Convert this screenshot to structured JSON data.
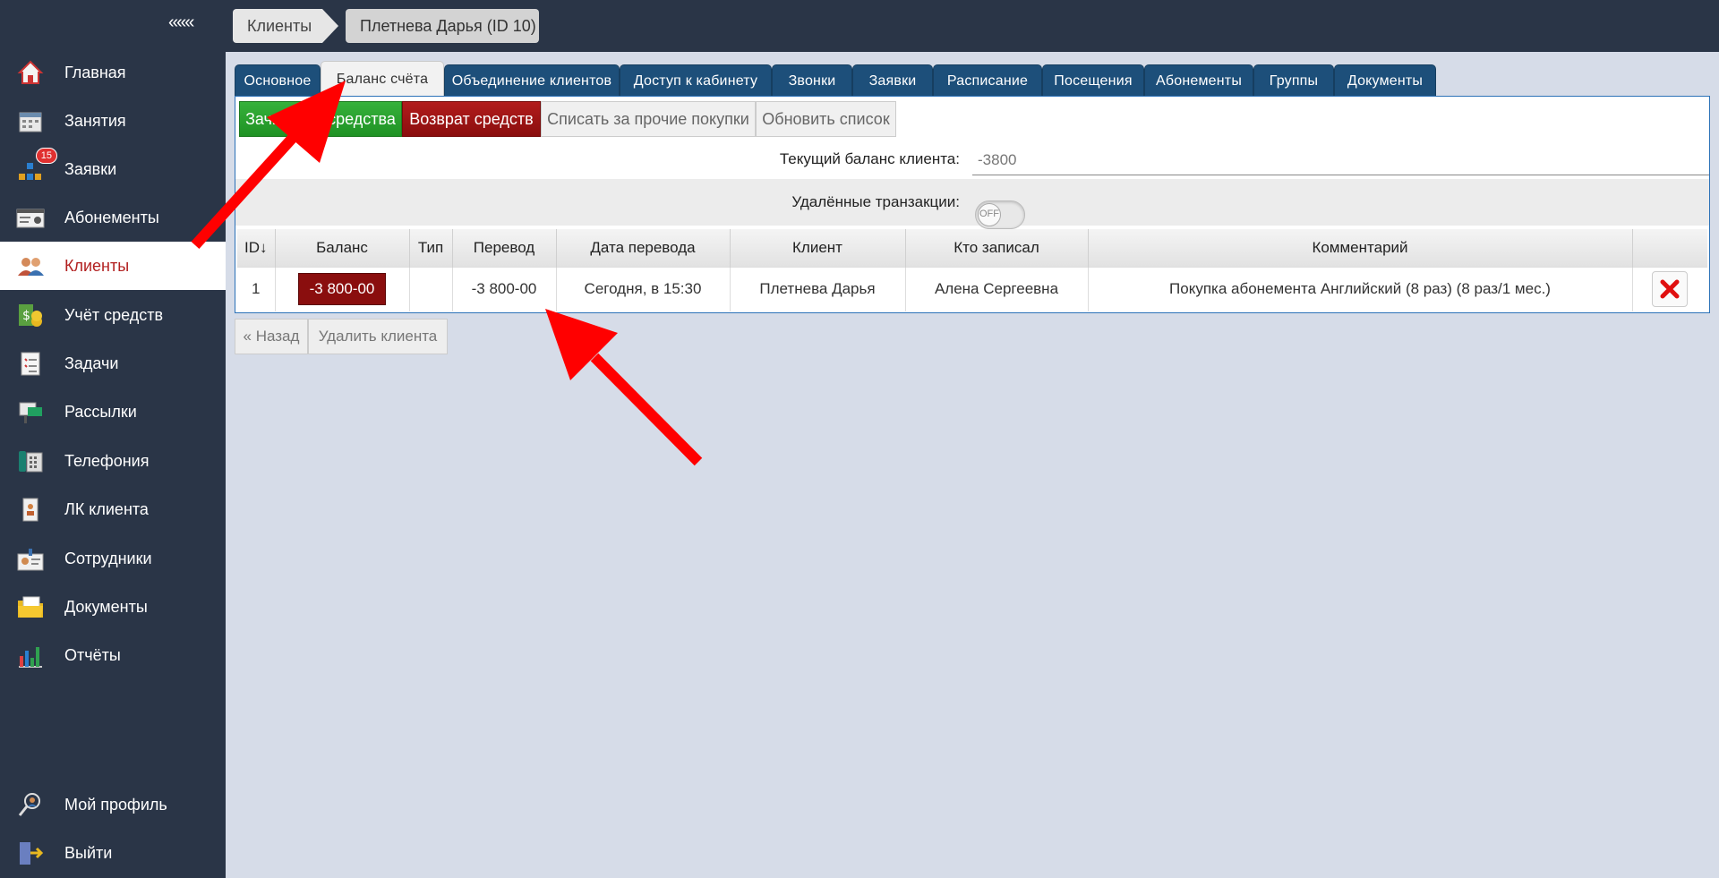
{
  "sidebar": {
    "collapse_label": "«««",
    "items": [
      {
        "label": "Главная",
        "icon": "home-icon"
      },
      {
        "label": "Занятия",
        "icon": "calendar-icon"
      },
      {
        "label": "Заявки",
        "icon": "requests-icon",
        "badge": "15"
      },
      {
        "label": "Абонементы",
        "icon": "membership-card-icon"
      },
      {
        "label": "Клиенты",
        "icon": "clients-icon",
        "active": true
      },
      {
        "label": "Учёт средств",
        "icon": "money-icon"
      },
      {
        "label": "Задачи",
        "icon": "tasks-icon"
      },
      {
        "label": "Рассылки",
        "icon": "mailing-icon"
      },
      {
        "label": "Телефония",
        "icon": "phone-icon"
      },
      {
        "label": "ЛК клиента",
        "icon": "client-cabinet-icon"
      },
      {
        "label": "Сотрудники",
        "icon": "staff-icon"
      },
      {
        "label": "Документы",
        "icon": "documents-icon"
      },
      {
        "label": "Отчёты",
        "icon": "reports-icon"
      }
    ],
    "bottom_items": [
      {
        "label": "Мой профиль",
        "icon": "profile-icon"
      },
      {
        "label": "Выйти",
        "icon": "logout-icon"
      }
    ]
  },
  "breadcrumb": {
    "parent": "Клиенты",
    "current": "Плетнева Дарья (ID 10)"
  },
  "tabs": [
    {
      "label": "Основное"
    },
    {
      "label": "Баланс счёта",
      "active": true
    },
    {
      "label": "Объединение клиентов"
    },
    {
      "label": "Доступ к кабинету"
    },
    {
      "label": "Звонки"
    },
    {
      "label": "Заявки"
    },
    {
      "label": "Расписание"
    },
    {
      "label": "Посещения"
    },
    {
      "label": "Абонементы"
    },
    {
      "label": "Группы"
    },
    {
      "label": "Документы"
    }
  ],
  "actions": {
    "credit": "Зачислить средства",
    "refund": "Возврат средств",
    "debit_other": "Списать за прочие покупки",
    "refresh": "Обновить список"
  },
  "balance": {
    "label": "Текущий баланс клиента:",
    "value": "-3800"
  },
  "deleted": {
    "label": "Удалённые транзакции:",
    "toggle": "OFF"
  },
  "table": {
    "headers": [
      "ID↓",
      "Баланс",
      "Тип",
      "Перевод",
      "Дата перевода",
      "Клиент",
      "Кто записал",
      "Комментарий",
      ""
    ],
    "rows": [
      {
        "id": "1",
        "balance": "-3 800-00",
        "type": "",
        "transfer": "-3 800-00",
        "date": "Сегодня, в 15:30",
        "client": "Плетнева Дарья",
        "recorded_by": "Алена Сергеевна",
        "comment": "Покупка абонемента Английский (8 раз) (8 раз/1 мес.)"
      }
    ]
  },
  "footer": {
    "back": "« Назад",
    "delete_client": "Удалить клиента"
  },
  "colors": {
    "sidebar": "#2a3547",
    "tab": "#1d4f7a",
    "green": "#1f9224",
    "red": "#8a0e0e",
    "annotation_arrow": "#ff0000"
  }
}
